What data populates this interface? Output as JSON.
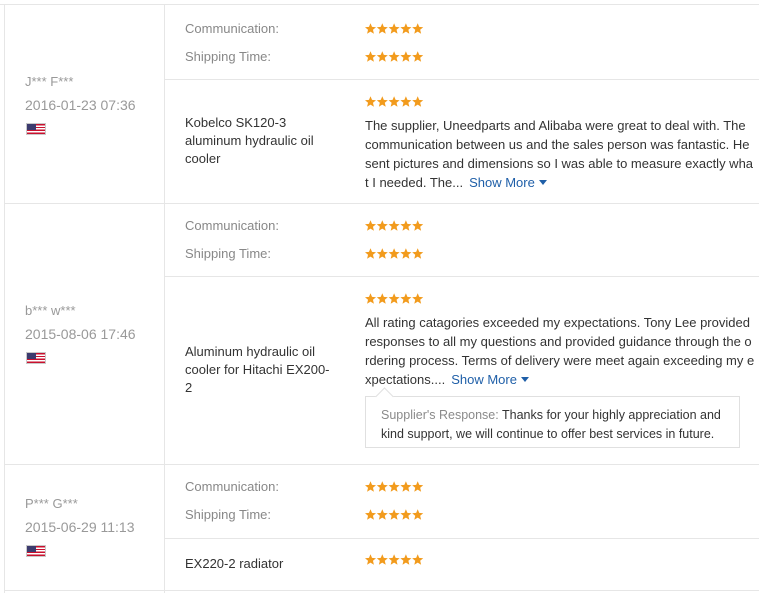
{
  "colors": {
    "star": "#f29b1d",
    "link": "#1f5fa8",
    "muted": "#999999",
    "border": "#e6e6e6"
  },
  "icons": {
    "rating": "star-icon",
    "country": "us-flag-icon",
    "expand": "caret-down-icon"
  },
  "labels": {
    "communication": "Communication:",
    "shipping_time": "Shipping Time:",
    "show_more": "Show More"
  },
  "reviews": [
    {
      "buyer": "J*** F***",
      "date": "2016-01-23 07:36",
      "country": "US",
      "communication_stars": 5,
      "shipping_stars": 5,
      "product": "Kobelco SK120-3 aluminum hydraulic oil cooler",
      "rating_stars": 5,
      "text": "The supplier, Uneedparts and Alibaba were great to deal with. The communication between us and the sales person was fantastic. He sent pictures and dimensions so I was able to measure exactly what I needed. The..."
    },
    {
      "buyer": "b*** w***",
      "date": "2015-08-06 17:46",
      "country": "US",
      "communication_stars": 5,
      "shipping_stars": 5,
      "product": "Aluminum hydraulic oil cooler for Hitachi EX200-2",
      "rating_stars": 5,
      "text": "All rating catagories exceeded my expectations. Tony Lee provided responses to all my questions and provided guidance through the ordering process. Terms of delivery were meet again exceeding my expectations....",
      "response_label": "Supplier's Response:",
      "response_text": "Thanks for your highly appreciation and kind support, we will continue to offer best services in future."
    },
    {
      "buyer": "P*** G***",
      "date": "2015-06-29 11:13",
      "country": "US",
      "communication_stars": 5,
      "shipping_stars": 5,
      "product": "EX220-2 radiator",
      "rating_stars": 5
    }
  ]
}
